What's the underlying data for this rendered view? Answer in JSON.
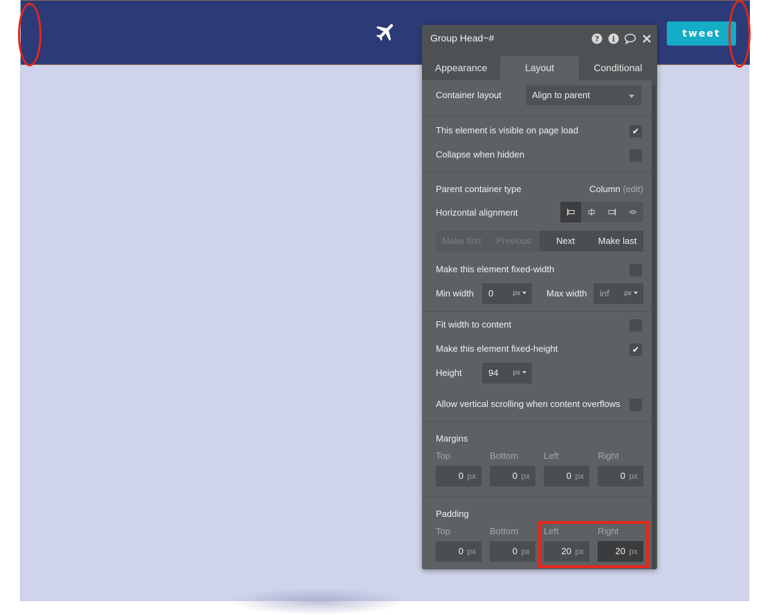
{
  "header": {
    "tweet_label": "tweet",
    "plane_icon": "airplane-icon"
  },
  "panel": {
    "title": "Group Head~#",
    "icons": [
      "help-icon",
      "info-icon",
      "comment-icon",
      "close-icon"
    ],
    "tabs": [
      "Appearance",
      "Layout",
      "Conditional"
    ],
    "active_tab": "Layout",
    "container_layout_label": "Container layout",
    "container_layout_value": "Align to parent",
    "visible_on_load_label": "This element is visible on page load",
    "visible_on_load": true,
    "collapse_hidden_label": "Collapse when hidden",
    "collapse_hidden": false,
    "parent_type_label": "Parent container type",
    "parent_type_value": "Column",
    "parent_type_edit": "(edit)",
    "h_align_label": "Horizontal alignment",
    "order_buttons": [
      "Make first",
      "Previous",
      "Next",
      "Make last"
    ],
    "fixed_width_label": "Make this element fixed-width",
    "fixed_width": false,
    "min_width_label": "Min width",
    "min_width_value": "0",
    "max_width_label": "Max width",
    "max_width_value": "inf",
    "unit_px": "px",
    "fit_width_label": "Fit width to content",
    "fit_width": false,
    "fixed_height_label": "Make this element fixed-height",
    "fixed_height": true,
    "height_label": "Height",
    "height_value": "94",
    "scroll_label": "Allow vertical scrolling when content overflows",
    "scroll": false,
    "margins_label": "Margins",
    "padding_label": "Padding",
    "side_labels": [
      "Top",
      "Bottom",
      "Left",
      "Right"
    ],
    "margins": [
      "0",
      "0",
      "0",
      "0"
    ],
    "padding": [
      "0",
      "0",
      "20",
      "20"
    ]
  },
  "colors": {
    "header_bg": "#2c3b78",
    "canvas_bg": "#cfd4ea",
    "tweet_btn": "#14acc6",
    "panel_bg": "#5e6164",
    "highlight": "#e8261a"
  }
}
